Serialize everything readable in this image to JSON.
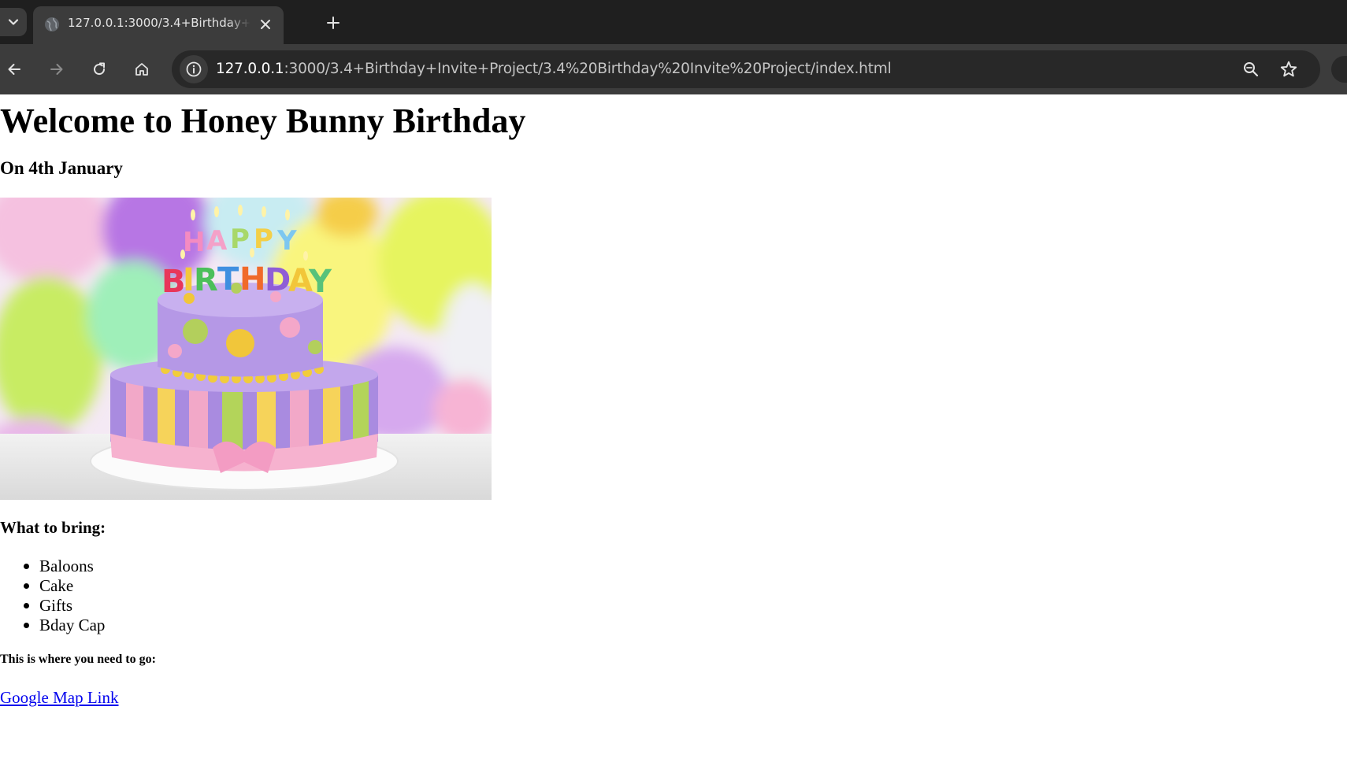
{
  "browser": {
    "tab": {
      "title": "127.0.0.1:3000/3.4+Birthday+Invite+Project/3.4%20Birthday%20Invite%20Project/index.html",
      "favicon_icon": "globe-icon"
    },
    "address_bar": {
      "host": "127.0.0.1",
      "path": ":3000/3.4+Birthday+Invite+Project/3.4%20Birthday%20Invite%20Project/index.html"
    },
    "icons": {
      "tab_search": "chevron-down-icon",
      "close_tab": "close-icon",
      "new_tab": "plus-icon",
      "back": "arrow-left-icon",
      "forward": "arrow-right-icon",
      "reload": "reload-icon",
      "home": "home-icon",
      "site_info": "info-icon",
      "zoom": "zoom-icon",
      "bookmark": "star-icon"
    },
    "colors": {
      "tabstrip": "#1f1f1f",
      "toolbar": "#3c3c3c",
      "omnibox": "#282828"
    }
  },
  "page": {
    "title": "Welcome to Honey Bunny Birthday",
    "subtitle": "On 4th January",
    "image": {
      "cake_lettering": "HAPPY BIRTHDAY"
    },
    "bring_heading": "What to bring:",
    "bring_items": [
      "Baloons",
      "Cake",
      "Gifts",
      "Bday Cap"
    ],
    "directions_heading": "This is where you need to go:",
    "map_link_text": "Google Map Link",
    "colors": {
      "link": "#0000ee",
      "text": "#000000"
    }
  }
}
